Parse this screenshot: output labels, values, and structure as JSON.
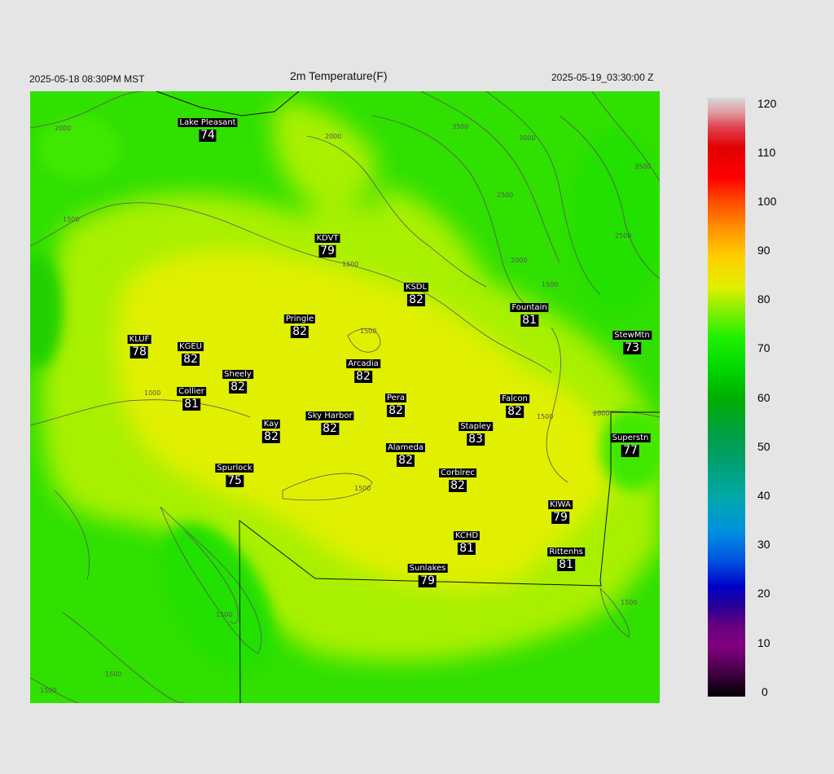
{
  "header": {
    "title": "2m Temperature(F)",
    "valid_local": "2025-05-18 08:30PM MST",
    "valid_utc": "2025-05-19_03:30:00 Z"
  },
  "colors": {
    "background": "#e5e5e5",
    "warm_fill": "#e0f000",
    "mild_fill": "#a8f000",
    "cool_fill": "#30e000",
    "contour": "#555555",
    "boundary": "#111111"
  },
  "contour_labels": [
    "2000",
    "1500",
    "2000",
    "3500",
    "3000",
    "2500",
    "3500",
    "2500",
    "2000",
    "1500",
    "1500",
    "1500",
    "1000",
    "1500",
    "2000",
    "1500",
    "1500",
    "1500",
    "1500",
    "1500"
  ],
  "stations": [
    {
      "name": "Lake Pleasant",
      "value": "74"
    },
    {
      "name": "KDVT",
      "value": "79"
    },
    {
      "name": "KSDL",
      "value": "82"
    },
    {
      "name": "Fountain",
      "value": "81"
    },
    {
      "name": "StewMtn",
      "value": "73"
    },
    {
      "name": "Pringle",
      "value": "82"
    },
    {
      "name": "KLUF",
      "value": "78"
    },
    {
      "name": "KGEU",
      "value": "82"
    },
    {
      "name": "Arcadia",
      "value": "82"
    },
    {
      "name": "Sheely",
      "value": "82"
    },
    {
      "name": "Collier",
      "value": "81"
    },
    {
      "name": "Pera",
      "value": "82"
    },
    {
      "name": "Falcon",
      "value": "82"
    },
    {
      "name": "Sky Harbor",
      "value": "82"
    },
    {
      "name": "Kay",
      "value": "82"
    },
    {
      "name": "Stapley",
      "value": "83"
    },
    {
      "name": "Superstn",
      "value": "77"
    },
    {
      "name": "Alameda",
      "value": "82"
    },
    {
      "name": "Spurlock",
      "value": "75"
    },
    {
      "name": "Corblrec",
      "value": "82"
    },
    {
      "name": "KIWA",
      "value": "79"
    },
    {
      "name": "KCHD",
      "value": "81"
    },
    {
      "name": "Rittenhs",
      "value": "81"
    },
    {
      "name": "Sunlakes",
      "value": "79"
    }
  ],
  "colorbar": {
    "ticks": [
      "120",
      "110",
      "100",
      "90",
      "80",
      "70",
      "60",
      "50",
      "40",
      "30",
      "20",
      "10",
      "0"
    ],
    "stops": [
      {
        "value": 0,
        "color": "#000000"
      },
      {
        "value": 4,
        "color": "#3a003a"
      },
      {
        "value": 10,
        "color": "#800080"
      },
      {
        "value": 14,
        "color": "#6a0080"
      },
      {
        "value": 18,
        "color": "#2a0098"
      },
      {
        "value": 22,
        "color": "#0000c8"
      },
      {
        "value": 27,
        "color": "#0050e0"
      },
      {
        "value": 33,
        "color": "#0090e0"
      },
      {
        "value": 40,
        "color": "#00a8a8"
      },
      {
        "value": 47,
        "color": "#00a070"
      },
      {
        "value": 53,
        "color": "#00a040"
      },
      {
        "value": 60,
        "color": "#00b000"
      },
      {
        "value": 66,
        "color": "#00d800"
      },
      {
        "value": 72,
        "color": "#20f000"
      },
      {
        "value": 78,
        "color": "#90f000"
      },
      {
        "value": 82,
        "color": "#e0f000"
      },
      {
        "value": 88,
        "color": "#ffd000"
      },
      {
        "value": 94,
        "color": "#ff9000"
      },
      {
        "value": 100,
        "color": "#ff4000"
      },
      {
        "value": 104,
        "color": "#ff0000"
      },
      {
        "value": 110,
        "color": "#e00000"
      },
      {
        "value": 114,
        "color": "#e04050"
      },
      {
        "value": 117,
        "color": "#e09aa0"
      },
      {
        "value": 120,
        "color": "#d8d8d8"
      }
    ]
  }
}
